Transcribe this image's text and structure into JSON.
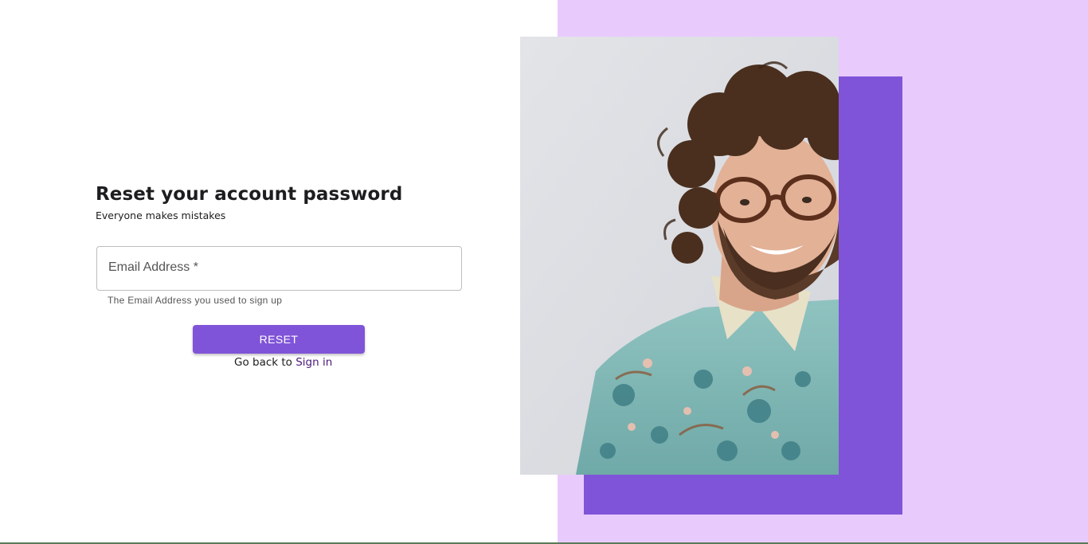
{
  "form": {
    "title": "Reset your account password",
    "subtitle": "Everyone makes mistakes",
    "email_label": "Email Address *",
    "email_value": "",
    "email_helper": "The Email Address you used to sign up",
    "reset_label": "RESET",
    "goback_text": "Go back to ",
    "signin_label": "Sign in"
  },
  "colors": {
    "accent": "#8054d8",
    "right_panel_bg": "#e9cafd",
    "link": "#4a1a7a"
  },
  "hero": {
    "image": "smiling-curly-haired-man-with-glasses-in-floral-shirt"
  }
}
